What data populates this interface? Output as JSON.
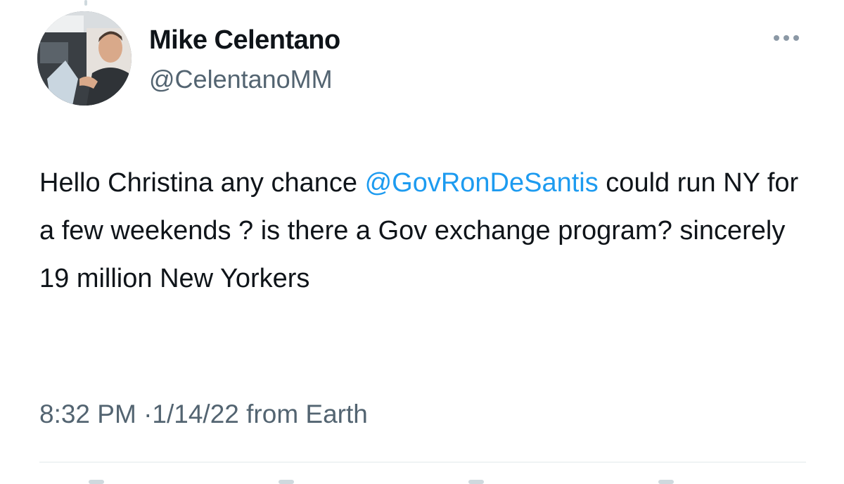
{
  "author": {
    "display_name": "Mike Celentano",
    "handle": "@CelentanoMM",
    "avatar_icon": "profile-photo"
  },
  "tweet": {
    "text_before_mention": "Hello Christina any chance ",
    "mention": "@GovRonDeSantis",
    "text_after_mention": " could run NY for a few weekends ? is there a Gov exchange program? sincerely 19 million New Yorkers"
  },
  "meta": {
    "time": "8:32 PM",
    "separator": "·",
    "date": "1/14/22",
    "source": "from Earth"
  },
  "icons": {
    "more": "more-options-icon"
  },
  "colors": {
    "text": "#0f1419",
    "secondary_text": "#536471",
    "link": "#1d9bf0",
    "divider": "#eff3f4"
  }
}
